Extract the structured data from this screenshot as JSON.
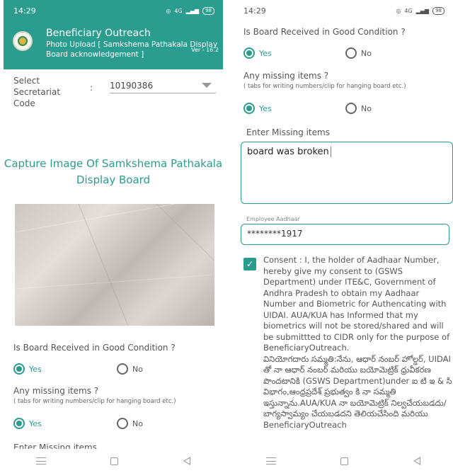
{
  "status": {
    "time": "14:29",
    "network": "4G",
    "battery": "98"
  },
  "app": {
    "title": "Beneficiary Outreach",
    "subtitle": "Photo Upload [ Samkshema Pathakala Display Board acknowledgement ]",
    "version": "Ver - 16.2",
    "accent_color": "#2a9d8f"
  },
  "secretariat": {
    "label": "Select Secretariat Code",
    "colon": ":",
    "value": "10190386"
  },
  "capture": {
    "title": "Capture  Image Of Samkshema Pathakala Display Board"
  },
  "questions": {
    "condition": {
      "label": "Is Board Received in Good Condition ?",
      "yes": "Yes",
      "no": "No",
      "selected": "Yes"
    },
    "missing": {
      "label": "Any missing items ?",
      "hint": "( tabs for writing numbers/clip for hanging board etc.)",
      "yes": "Yes",
      "no": "No",
      "selected": "Yes"
    },
    "enter_missing_label": "Enter Missing items",
    "enter_missing_value": "board was broken"
  },
  "aadhaar": {
    "label": "Employee Aadhaar",
    "value": "********1917"
  },
  "consent": {
    "checked": true,
    "english": "Consent : I, the holder of Aadhaar Number, hereby give my consent to (GSWS Department) under ITE&C, Government of Andhra Pradesh to obtain my Aadhaar Number and Biometric for Authencating with UIDAI. AUA/KUA has Informed that my biometrics will not be stored/shared and will be submittted to CIDR only for the purpose of BeneficiaryOutreach.",
    "telugu": "వినియోగదారు సమ్మతి:నేను, ఆధార్ నంబర్ హోల్డర్, UIDAI తో నా ఆధార్ నంబర్ మరియు బయోమెట్రిక్ ధ్రువీకరణ పొందటానికి (GSWS Department)under ఐ టి ఇ & సి విభాగం,ఆంధ్రప్రదేశ్ ప్రభుత్వం కి నా సమ్మతి ఇస్తున్నాను.AUA/KUA నా బయోమెట్రిక్ నిల్వచేయబడదు/బాగ్యస్వామ్యం చేయబడదని తెలియచేసింది మరియు BeneficiaryOutreach"
  },
  "nav": {
    "menu_icon": "menu-icon",
    "home_icon": "home-icon",
    "back_icon": "back-icon"
  }
}
